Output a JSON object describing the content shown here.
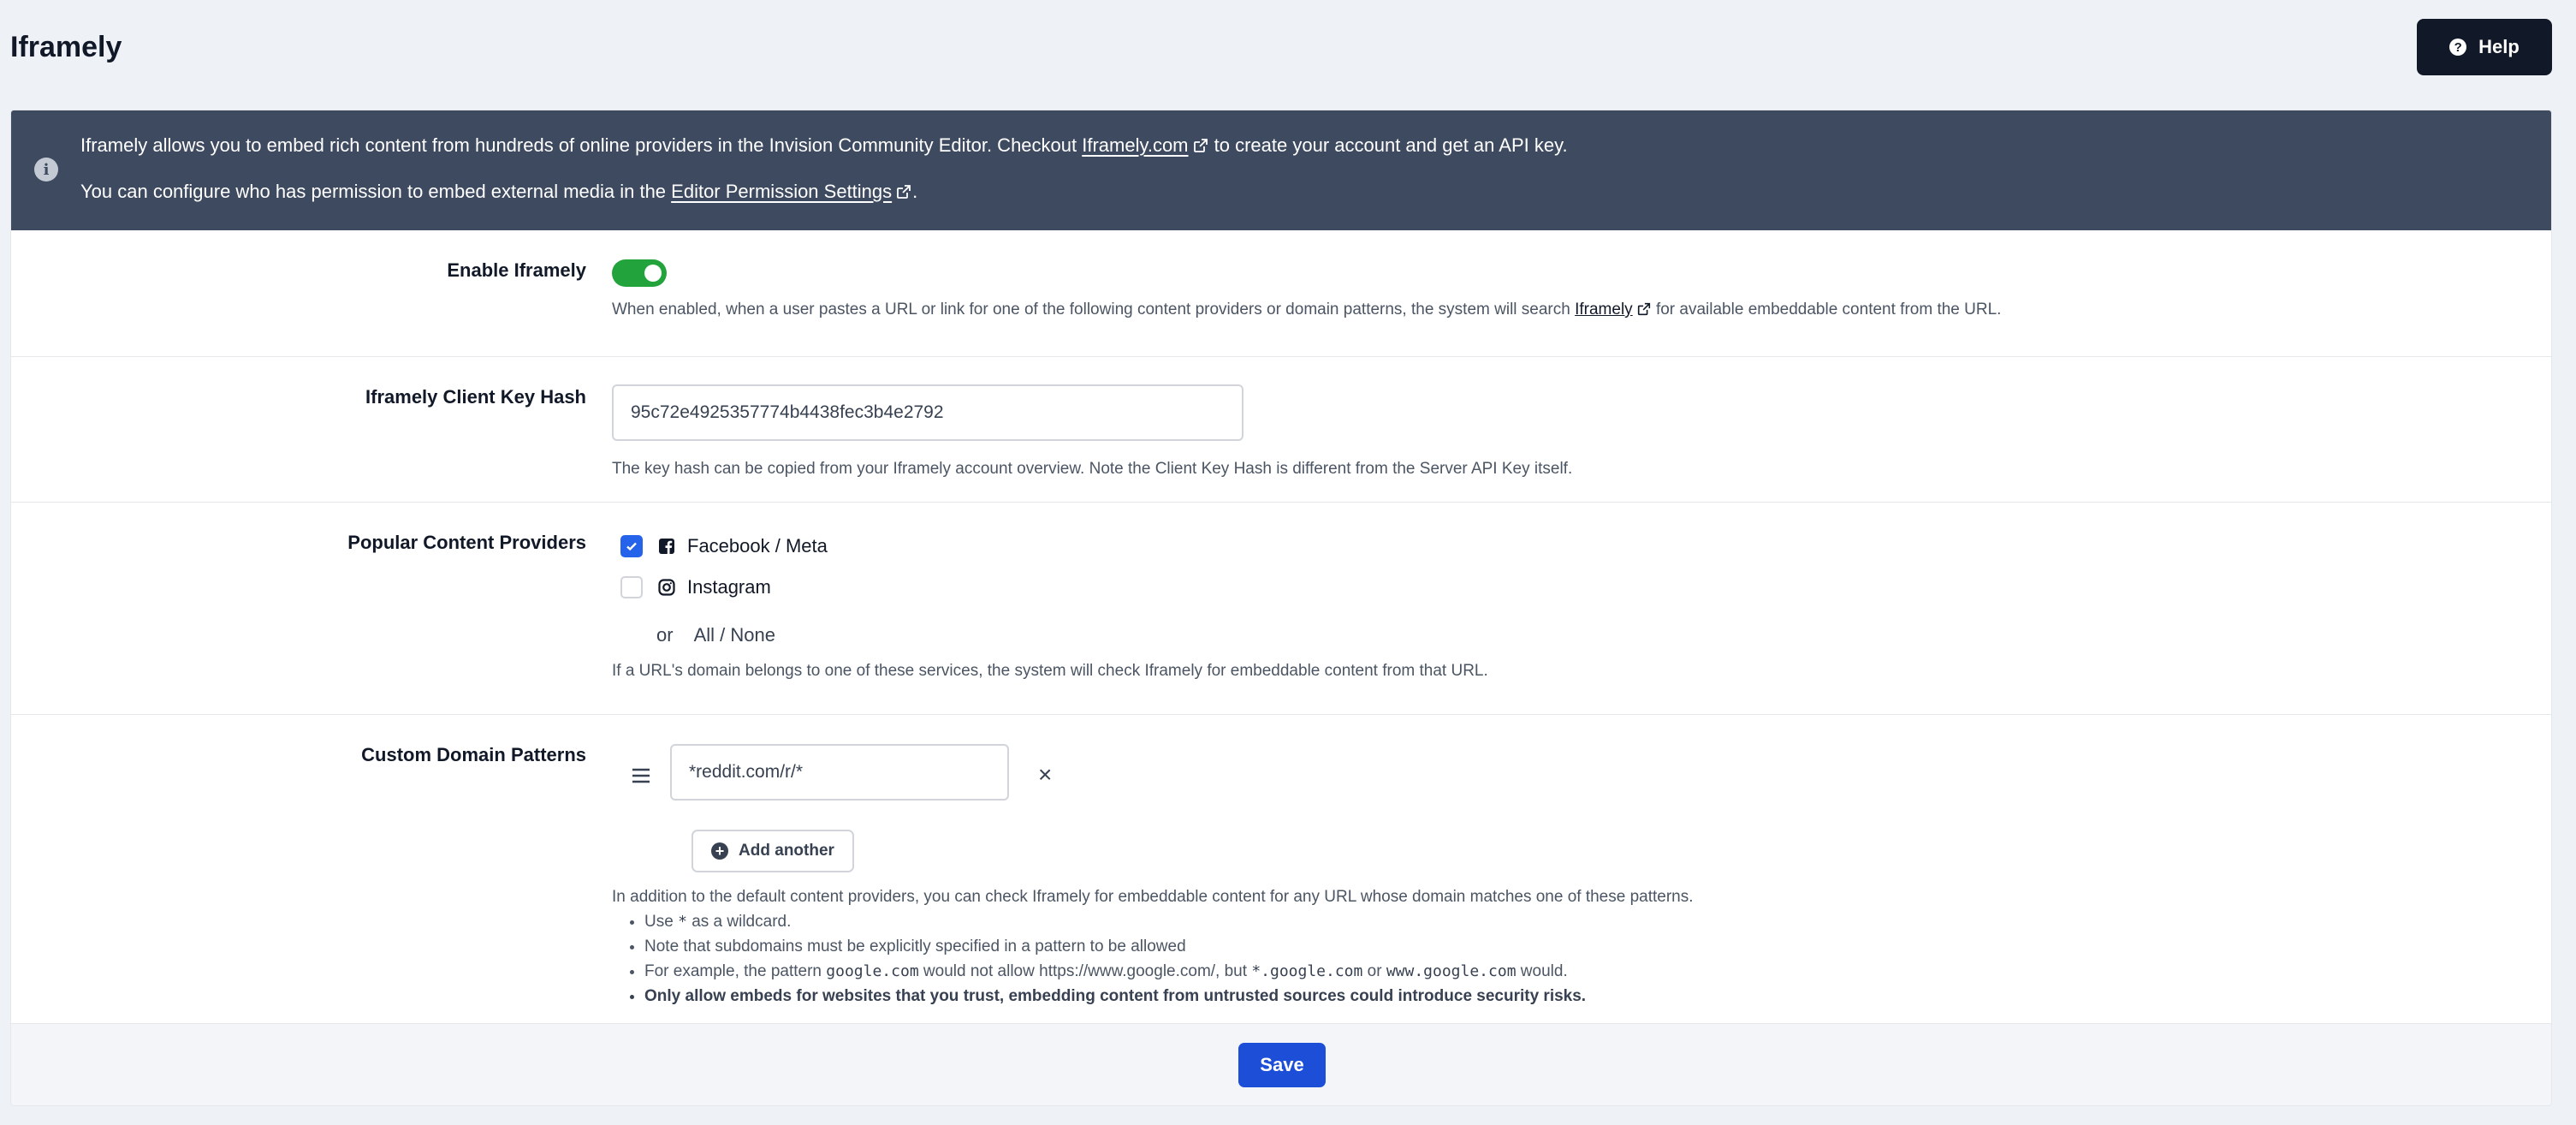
{
  "page": {
    "title": "Iframely"
  },
  "header": {
    "help_label": "Help"
  },
  "banner": {
    "line1_pre": "Iframely allows you to embed rich content from hundreds of online providers in the Invision Community Editor. Checkout ",
    "line1_link": "Iframely.com",
    "line1_post": " to create your account and get an API key.",
    "line2_pre": "You can configure who has permission to embed external media in the ",
    "line2_link": "Editor Permission Settings",
    "line2_post": "."
  },
  "enable": {
    "label": "Enable Iframely",
    "enabled": true,
    "desc_pre": "When enabled, when a user pastes a URL or link for one of the following content providers or domain patterns, the system will search ",
    "desc_link": "Iframely",
    "desc_post": " for available embeddable content from the URL."
  },
  "client_key": {
    "label": "Iframely Client Key Hash",
    "value": "95c72e4925357774b4438fec3b4e2792",
    "desc": "The key hash can be copied from your Iframely account overview. Note the Client Key Hash is different from the Server API Key itself."
  },
  "providers": {
    "label": "Popular Content Providers",
    "items": [
      {
        "name": "Facebook / Meta",
        "icon": "facebook-icon",
        "checked": true
      },
      {
        "name": "Instagram",
        "icon": "instagram-icon",
        "checked": false
      }
    ],
    "or_label": "or",
    "all_none_label": "All / None",
    "desc": "If a URL's domain belongs to one of these services, the system will check Iframely for embeddable content from that URL."
  },
  "custom": {
    "label": "Custom Domain Patterns",
    "patterns": [
      "*reddit.com/r/*"
    ],
    "add_label": "Add another",
    "intro": "In addition to the default content providers, you can check Iframely for embeddable content for any URL whose domain matches one of these patterns.",
    "bullet1_pre": "Use ",
    "bullet1_code": "*",
    "bullet1_post": " as a wildcard.",
    "bullet2": "Note that subdomains must be explicitly specified in a pattern to be allowed",
    "bullet3_pre": "For example, the pattern ",
    "bullet3_code1": "google.com",
    "bullet3_mid": " would not allow https://www.google.com/, but ",
    "bullet3_code2": "*.google.com",
    "bullet3_or": " or ",
    "bullet3_code3": "www.google.com",
    "bullet3_post": " would.",
    "bullet4": "Only allow embeds for websites that you trust, embedding content from untrusted sources could introduce security risks."
  },
  "footer": {
    "save_label": "Save"
  },
  "colors": {
    "banner_bg": "#3e4a5f",
    "toggle_on": "#22a33b",
    "primary": "#1d4ed8",
    "checkbox": "#2563eb"
  }
}
